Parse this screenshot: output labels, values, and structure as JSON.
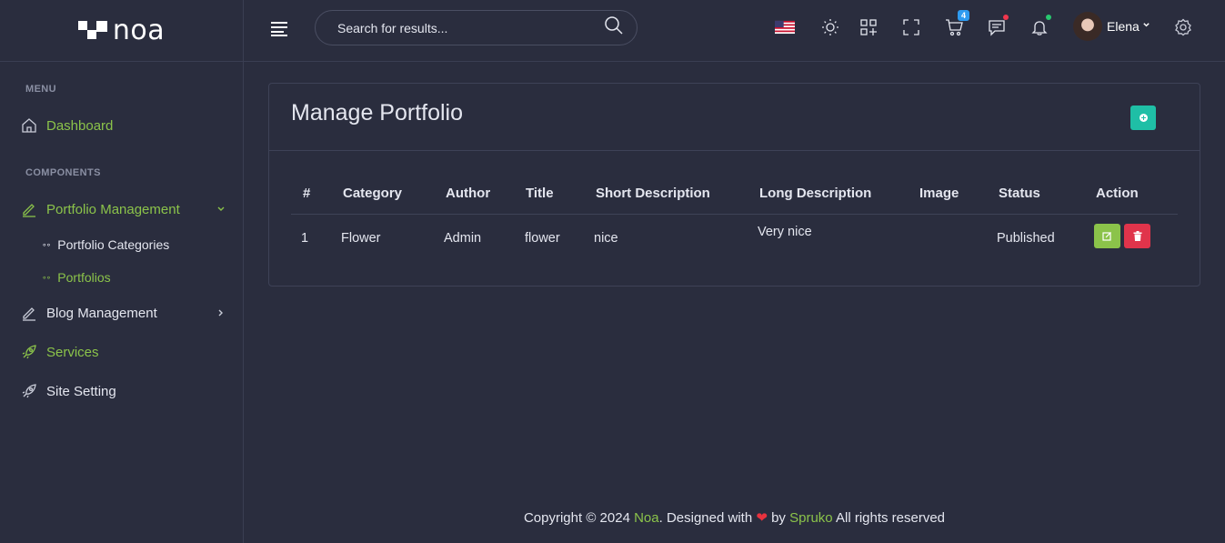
{
  "brand": {
    "name": "noa"
  },
  "search": {
    "placeholder": "Search for results..."
  },
  "header": {
    "cart_count": "4",
    "user_name": "Elena",
    "icons": [
      "us-flag-icon",
      "sun-icon",
      "apps-icon",
      "fullscreen-icon",
      "cart-icon",
      "chat-icon",
      "bell-icon",
      "settings-icon"
    ]
  },
  "sidebar": {
    "menu_label": "MENU",
    "components_label": "COMPONENTS",
    "items": [
      {
        "label": "Dashboard"
      },
      {
        "label": "Portfolio Management"
      },
      {
        "label": "Portfolio Categories"
      },
      {
        "label": "Portfolios"
      },
      {
        "label": "Blog Management"
      },
      {
        "label": "Services"
      },
      {
        "label": "Site Setting"
      }
    ]
  },
  "main": {
    "title": "Manage Portfolio",
    "table": {
      "headers": [
        "#",
        "Category",
        "Author",
        "Title",
        "Short Description",
        "Long Description",
        "Image",
        "Status",
        "Action"
      ],
      "rows": [
        [
          "1",
          "Flower",
          "Admin",
          "flower",
          "nice",
          "Very nice",
          "",
          "Published"
        ]
      ]
    }
  },
  "footer": {
    "prefix": "Copyright © 2024 ",
    "brand": "Noa",
    "mid": ". Designed with ",
    "by": " by ",
    "author": "Spruko",
    "suffix": " All rights reserved"
  },
  "colors": {
    "accent": "#8bc34a",
    "teal": "#1fbfa6",
    "danger": "#e8323e",
    "bg": "#2a2d3e"
  }
}
